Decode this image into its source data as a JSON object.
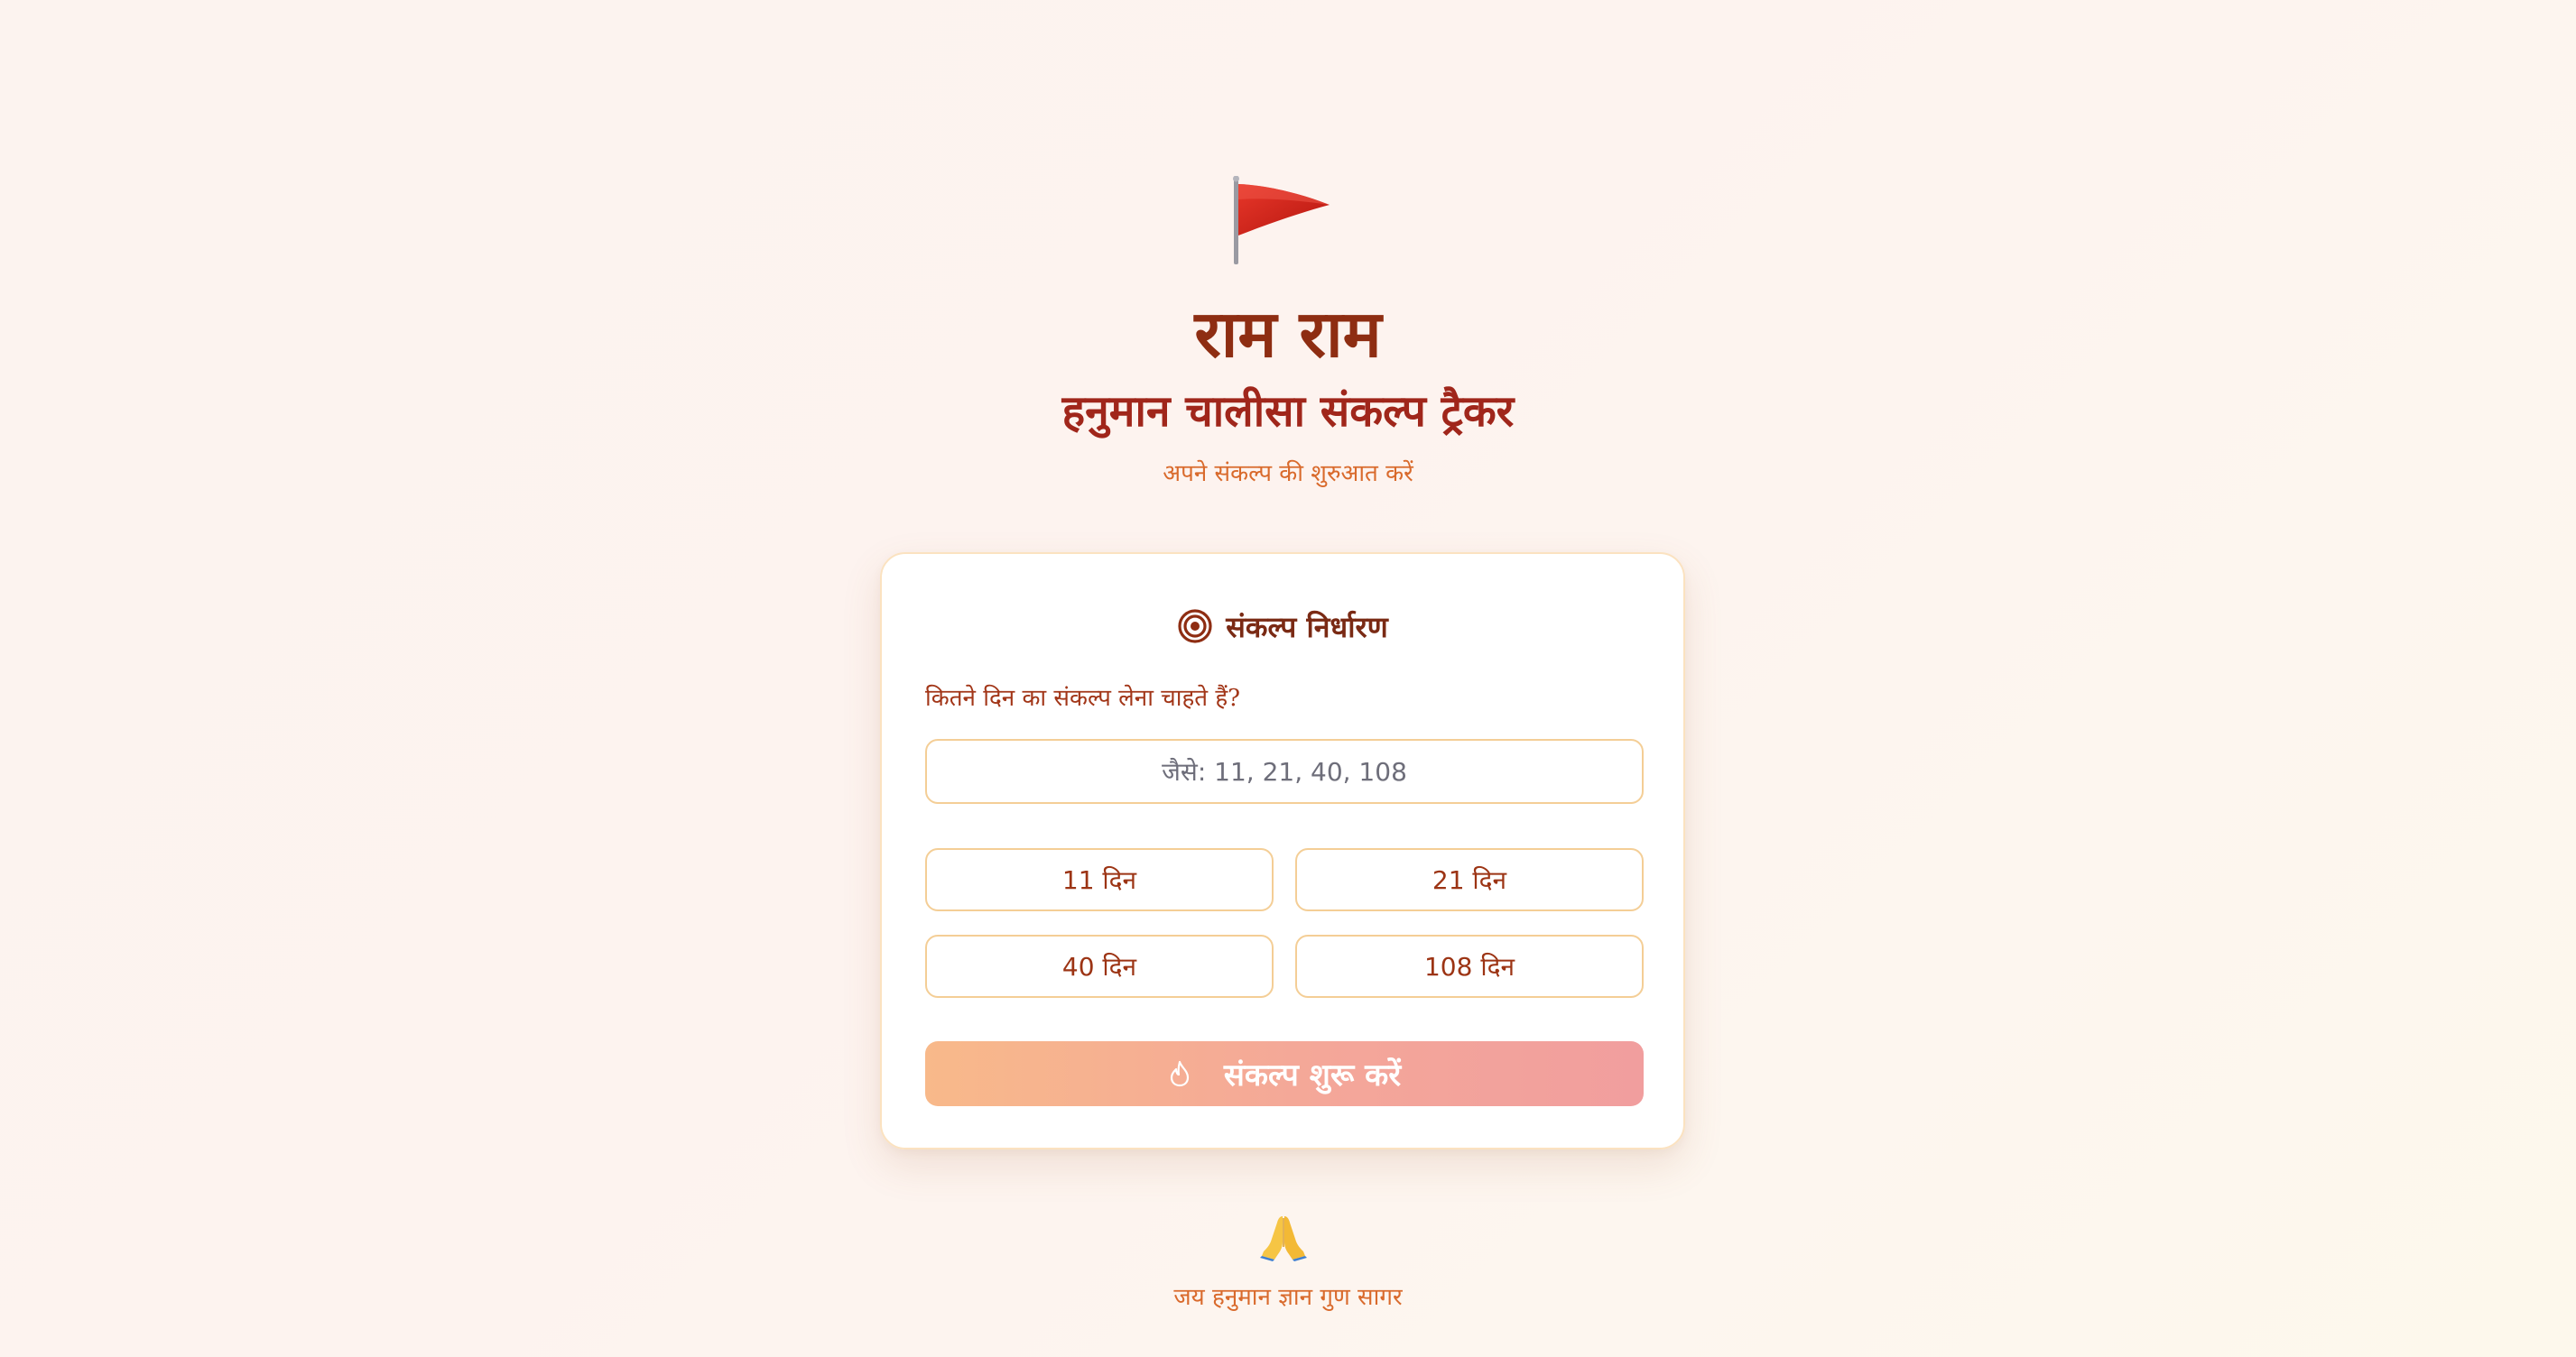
{
  "header": {
    "flag_icon": "saffron-flag-icon",
    "title": "राम राम",
    "subtitle": "हनुमान चालीसा संकल्प ट्रैकर",
    "tagline": "अपने संकल्प की शुरुआत करें"
  },
  "card": {
    "icon": "target-icon",
    "title": "संकल्प निर्धारण",
    "question": "कितने दिन का संकल्प लेना चाहते हैं?",
    "input": {
      "placeholder": "जैसे: 11, 21, 40, 108",
      "value": ""
    },
    "presets": [
      {
        "label": "11 दिन"
      },
      {
        "label": "21 दिन"
      },
      {
        "label": "40 दिन"
      },
      {
        "label": "108 दिन"
      }
    ],
    "start_button": {
      "icon": "fire-icon",
      "label": "संकल्प शुरू करें"
    }
  },
  "footer": {
    "icon": "folded-hands-icon",
    "text": "जय हनुमान ज्ञान गुण सागर"
  },
  "colors": {
    "title": "#8e2d12",
    "subtitle": "#a0261b",
    "accent": "#d96a2c",
    "card_border": "#fbe2c0",
    "input_border": "#f4ce96",
    "button_gradient_start": "#f8b98a",
    "button_gradient_end": "#f19e9e"
  }
}
